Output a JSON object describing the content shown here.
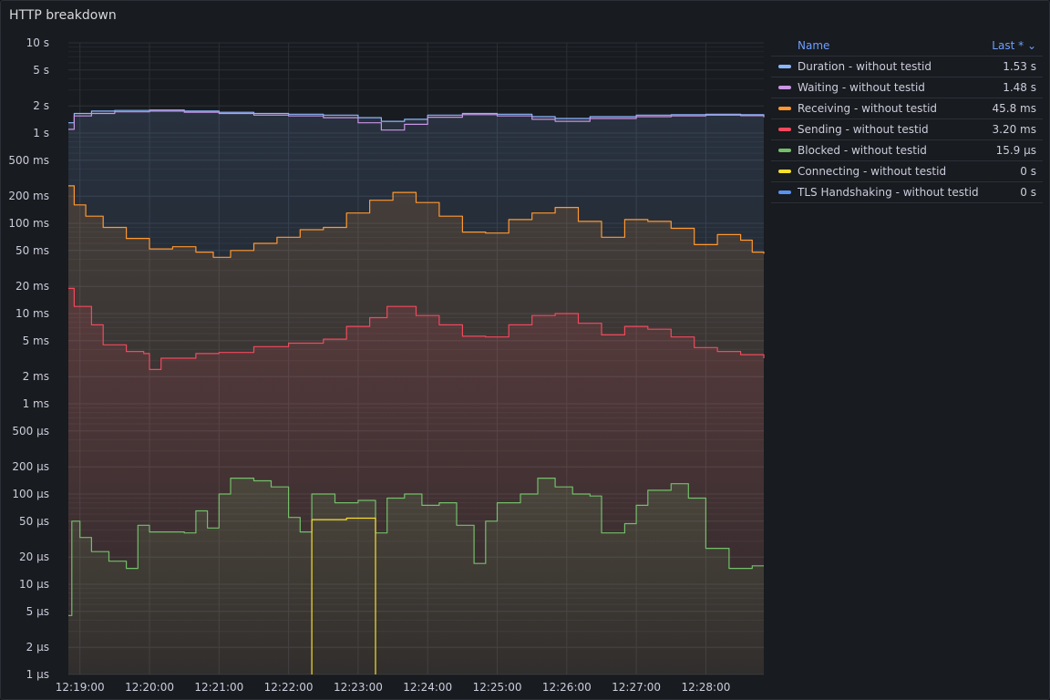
{
  "panel": {
    "title": "HTTP breakdown"
  },
  "legend": {
    "name_header": "Name",
    "value_header": "Last *",
    "rows": [
      {
        "name": "Duration - without testid",
        "last": "1.53 s",
        "color": "#8ab8ff"
      },
      {
        "name": "Waiting - without testid",
        "last": "1.48 s",
        "color": "#ca95e5"
      },
      {
        "name": "Receiving - without testid",
        "last": "45.8 ms",
        "color": "#ff9830"
      },
      {
        "name": "Sending - without testid",
        "last": "3.20 ms",
        "color": "#f2495c"
      },
      {
        "name": "Blocked - without testid",
        "last": "15.9 µs",
        "color": "#73bf69"
      },
      {
        "name": "Connecting - without testid",
        "last": "0 s",
        "color": "#fade2a"
      },
      {
        "name": "TLS Handshaking - without testid",
        "last": "0 s",
        "color": "#5794f2"
      }
    ]
  },
  "chart_data": {
    "type": "line",
    "title": "HTTP breakdown",
    "xlabel": "",
    "ylabel": "",
    "y_scale": "log",
    "y_unit": "seconds",
    "ylim": [
      1e-06,
      10
    ],
    "xlim": [
      "12:18:50",
      "12:28:50"
    ],
    "x_ticks": [
      "12:19:00",
      "12:20:00",
      "12:21:00",
      "12:22:00",
      "12:23:00",
      "12:24:00",
      "12:25:00",
      "12:26:00",
      "12:27:00",
      "12:28:00"
    ],
    "y_ticks": [
      {
        "v": 10,
        "label": "10 s"
      },
      {
        "v": 5,
        "label": "5 s"
      },
      {
        "v": 2,
        "label": "2 s"
      },
      {
        "v": 1,
        "label": "1 s"
      },
      {
        "v": 0.5,
        "label": "500 ms"
      },
      {
        "v": 0.2,
        "label": "200 ms"
      },
      {
        "v": 0.1,
        "label": "100 ms"
      },
      {
        "v": 0.05,
        "label": "50 ms"
      },
      {
        "v": 0.02,
        "label": "20 ms"
      },
      {
        "v": 0.01,
        "label": "10 ms"
      },
      {
        "v": 0.005,
        "label": "5 ms"
      },
      {
        "v": 0.002,
        "label": "2 ms"
      },
      {
        "v": 0.001,
        "label": "1 ms"
      },
      {
        "v": 0.0005,
        "label": "500 µs"
      },
      {
        "v": 0.0002,
        "label": "200 µs"
      },
      {
        "v": 0.0001,
        "label": "100 µs"
      },
      {
        "v": 5e-05,
        "label": "50 µs"
      },
      {
        "v": 2e-05,
        "label": "20 µs"
      },
      {
        "v": 1e-05,
        "label": "10 µs"
      },
      {
        "v": 5e-06,
        "label": "5 µs"
      },
      {
        "v": 2e-06,
        "label": "2 µs"
      },
      {
        "v": 1e-06,
        "label": "1 µs"
      }
    ],
    "series": [
      {
        "name": "Duration - without testid",
        "color": "#8ab8ff",
        "fill": true,
        "points": [
          [
            "12:18:50",
            1.3
          ],
          [
            "12:18:55",
            1.65
          ],
          [
            "12:19:10",
            1.75
          ],
          [
            "12:19:30",
            1.78
          ],
          [
            "12:20:00",
            1.8
          ],
          [
            "12:20:30",
            1.75
          ],
          [
            "12:21:00",
            1.7
          ],
          [
            "12:21:30",
            1.65
          ],
          [
            "12:22:00",
            1.62
          ],
          [
            "12:22:30",
            1.58
          ],
          [
            "12:23:00",
            1.48
          ],
          [
            "12:23:20",
            1.35
          ],
          [
            "12:23:40",
            1.42
          ],
          [
            "12:24:00",
            1.58
          ],
          [
            "12:24:30",
            1.65
          ],
          [
            "12:25:00",
            1.62
          ],
          [
            "12:25:30",
            1.52
          ],
          [
            "12:25:50",
            1.45
          ],
          [
            "12:26:20",
            1.52
          ],
          [
            "12:27:00",
            1.58
          ],
          [
            "12:27:30",
            1.6
          ],
          [
            "12:28:00",
            1.62
          ],
          [
            "12:28:30",
            1.6
          ],
          [
            "12:28:50",
            1.55
          ]
        ]
      },
      {
        "name": "Waiting - without testid",
        "color": "#ca95e5",
        "fill": false,
        "points": [
          [
            "12:18:50",
            1.1
          ],
          [
            "12:18:55",
            1.55
          ],
          [
            "12:19:10",
            1.65
          ],
          [
            "12:19:30",
            1.72
          ],
          [
            "12:20:00",
            1.75
          ],
          [
            "12:20:30",
            1.7
          ],
          [
            "12:21:00",
            1.65
          ],
          [
            "12:21:30",
            1.58
          ],
          [
            "12:22:00",
            1.55
          ],
          [
            "12:22:30",
            1.48
          ],
          [
            "12:23:00",
            1.3
          ],
          [
            "12:23:20",
            1.08
          ],
          [
            "12:23:40",
            1.25
          ],
          [
            "12:24:00",
            1.5
          ],
          [
            "12:24:30",
            1.6
          ],
          [
            "12:25:00",
            1.55
          ],
          [
            "12:25:30",
            1.42
          ],
          [
            "12:25:50",
            1.35
          ],
          [
            "12:26:20",
            1.45
          ],
          [
            "12:27:00",
            1.52
          ],
          [
            "12:27:30",
            1.55
          ],
          [
            "12:28:00",
            1.58
          ],
          [
            "12:28:30",
            1.56
          ],
          [
            "12:28:50",
            1.5
          ]
        ]
      },
      {
        "name": "Receiving - without testid",
        "color": "#ff9830",
        "fill": true,
        "points": [
          [
            "12:18:50",
            0.26
          ],
          [
            "12:18:55",
            0.16
          ],
          [
            "12:19:05",
            0.12
          ],
          [
            "12:19:20",
            0.09
          ],
          [
            "12:19:40",
            0.068
          ],
          [
            "12:20:00",
            0.052
          ],
          [
            "12:20:20",
            0.055
          ],
          [
            "12:20:40",
            0.048
          ],
          [
            "12:20:55",
            0.042
          ],
          [
            "12:21:10",
            0.05
          ],
          [
            "12:21:30",
            0.06
          ],
          [
            "12:21:50",
            0.07
          ],
          [
            "12:22:10",
            0.085
          ],
          [
            "12:22:30",
            0.09
          ],
          [
            "12:22:50",
            0.13
          ],
          [
            "12:23:10",
            0.18
          ],
          [
            "12:23:30",
            0.22
          ],
          [
            "12:23:50",
            0.17
          ],
          [
            "12:24:10",
            0.12
          ],
          [
            "12:24:30",
            0.08
          ],
          [
            "12:24:50",
            0.078
          ],
          [
            "12:25:10",
            0.11
          ],
          [
            "12:25:30",
            0.13
          ],
          [
            "12:25:50",
            0.15
          ],
          [
            "12:26:10",
            0.105
          ],
          [
            "12:26:30",
            0.07
          ],
          [
            "12:26:50",
            0.11
          ],
          [
            "12:27:10",
            0.105
          ],
          [
            "12:27:30",
            0.088
          ],
          [
            "12:27:50",
            0.058
          ],
          [
            "12:28:10",
            0.075
          ],
          [
            "12:28:30",
            0.065
          ],
          [
            "12:28:40",
            0.048
          ],
          [
            "12:28:50",
            0.046
          ]
        ]
      },
      {
        "name": "Sending - without testid",
        "color": "#f2495c",
        "fill": true,
        "points": [
          [
            "12:18:50",
            0.019
          ],
          [
            "12:18:55",
            0.012
          ],
          [
            "12:19:10",
            0.0075
          ],
          [
            "12:19:20",
            0.0045
          ],
          [
            "12:19:40",
            0.0038
          ],
          [
            "12:19:55",
            0.0036
          ],
          [
            "12:20:00",
            0.0024
          ],
          [
            "12:20:10",
            0.0032
          ],
          [
            "12:20:40",
            0.0036
          ],
          [
            "12:21:00",
            0.0037
          ],
          [
            "12:21:30",
            0.0043
          ],
          [
            "12:22:00",
            0.0047
          ],
          [
            "12:22:30",
            0.0052
          ],
          [
            "12:22:50",
            0.0072
          ],
          [
            "12:23:10",
            0.009
          ],
          [
            "12:23:25",
            0.012
          ],
          [
            "12:23:50",
            0.0095
          ],
          [
            "12:24:10",
            0.0075
          ],
          [
            "12:24:30",
            0.0056
          ],
          [
            "12:24:50",
            0.0055
          ],
          [
            "12:25:10",
            0.0075
          ],
          [
            "12:25:30",
            0.0095
          ],
          [
            "12:25:50",
            0.01
          ],
          [
            "12:26:10",
            0.0078
          ],
          [
            "12:26:30",
            0.0058
          ],
          [
            "12:26:50",
            0.0072
          ],
          [
            "12:27:10",
            0.0067
          ],
          [
            "12:27:30",
            0.0055
          ],
          [
            "12:27:50",
            0.0042
          ],
          [
            "12:28:10",
            0.0038
          ],
          [
            "12:28:30",
            0.0035
          ],
          [
            "12:28:50",
            0.0032
          ]
        ]
      },
      {
        "name": "Blocked - without testid",
        "color": "#73bf69",
        "fill": true,
        "points": [
          [
            "12:18:50",
            4.5e-06
          ],
          [
            "12:18:53",
            5e-05
          ],
          [
            "12:19:00",
            3.3e-05
          ],
          [
            "12:19:10",
            2.3e-05
          ],
          [
            "12:19:25",
            1.8e-05
          ],
          [
            "12:19:40",
            1.5e-05
          ],
          [
            "12:19:50",
            4.5e-05
          ],
          [
            "12:20:00",
            3.8e-05
          ],
          [
            "12:20:30",
            3.7e-05
          ],
          [
            "12:20:40",
            6.5e-05
          ],
          [
            "12:20:50",
            4.2e-05
          ],
          [
            "12:21:00",
            0.0001
          ],
          [
            "12:21:10",
            0.00015
          ],
          [
            "12:21:30",
            0.00014
          ],
          [
            "12:21:45",
            0.00012
          ],
          [
            "12:22:00",
            5.5e-05
          ],
          [
            "12:22:10",
            3.8e-05
          ],
          [
            "12:22:20",
            0.0001
          ],
          [
            "12:22:40",
            8e-05
          ],
          [
            "12:23:00",
            8.5e-05
          ],
          [
            "12:23:15",
            3.7e-05
          ],
          [
            "12:23:25",
            9e-05
          ],
          [
            "12:23:40",
            0.0001
          ],
          [
            "12:23:55",
            7.5e-05
          ],
          [
            "12:24:10",
            8e-05
          ],
          [
            "12:24:25",
            4.5e-05
          ],
          [
            "12:24:40",
            1.7e-05
          ],
          [
            "12:24:50",
            5e-05
          ],
          [
            "12:25:00",
            8e-05
          ],
          [
            "12:25:20",
            0.0001
          ],
          [
            "12:25:35",
            0.00015
          ],
          [
            "12:25:50",
            0.00012
          ],
          [
            "12:26:05",
            0.0001
          ],
          [
            "12:26:20",
            9.5e-05
          ],
          [
            "12:26:30",
            3.7e-05
          ],
          [
            "12:26:50",
            4.7e-05
          ],
          [
            "12:27:00",
            7.5e-05
          ],
          [
            "12:27:10",
            0.00011
          ],
          [
            "12:27:30",
            0.00013
          ],
          [
            "12:27:45",
            9e-05
          ],
          [
            "12:28:00",
            2.5e-05
          ],
          [
            "12:28:20",
            1.5e-05
          ],
          [
            "12:28:40",
            1.6e-05
          ],
          [
            "12:28:50",
            1.6e-05
          ]
        ]
      },
      {
        "name": "Connecting - without testid",
        "color": "#fade2a",
        "fill": false,
        "points": [
          [
            "12:22:20",
            1e-06
          ],
          [
            "12:22:20",
            5.2e-05
          ],
          [
            "12:22:50",
            5.4e-05
          ],
          [
            "12:23:15",
            5.2e-05
          ],
          [
            "12:23:15",
            1e-06
          ]
        ]
      },
      {
        "name": "TLS Handshaking - without testid",
        "color": "#5794f2",
        "fill": false,
        "points": []
      }
    ]
  }
}
